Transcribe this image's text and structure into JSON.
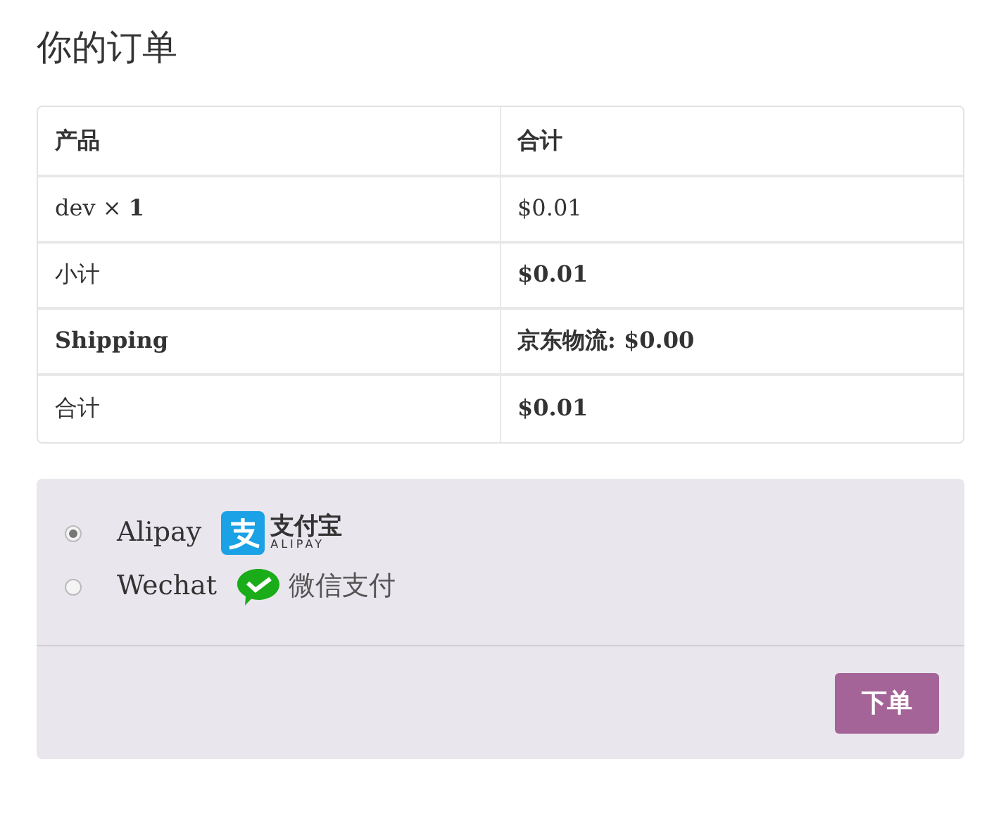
{
  "title": "你的订单",
  "table": {
    "columns": [
      "产品",
      "合计"
    ],
    "rows": [
      {
        "cells": [
          {
            "text": "dev  × **1**",
            "bold": false
          },
          {
            "text": "$0.01",
            "bold": false
          }
        ]
      },
      {
        "cells": [
          {
            "text": "小计",
            "bold": false
          },
          {
            "text": "$0.01",
            "bold": true
          }
        ]
      },
      {
        "cells": [
          {
            "text": "Shipping",
            "bold": true
          },
          {
            "text": "京东物流: $0.00",
            "bold": true
          }
        ]
      },
      {
        "cells": [
          {
            "text": "合计",
            "bold": false
          },
          {
            "text": "$0.01",
            "bold": true
          }
        ]
      }
    ]
  },
  "payment_methods": [
    {
      "label": "Alipay",
      "selected": true,
      "logo": {
        "kind": "alipay",
        "text": "支付宝",
        "subtext": "ALIPAY"
      }
    },
    {
      "label": "Wechat",
      "selected": false,
      "logo": {
        "kind": "wechat",
        "text": "微信支付"
      }
    }
  ],
  "place_order_button": "下单"
}
